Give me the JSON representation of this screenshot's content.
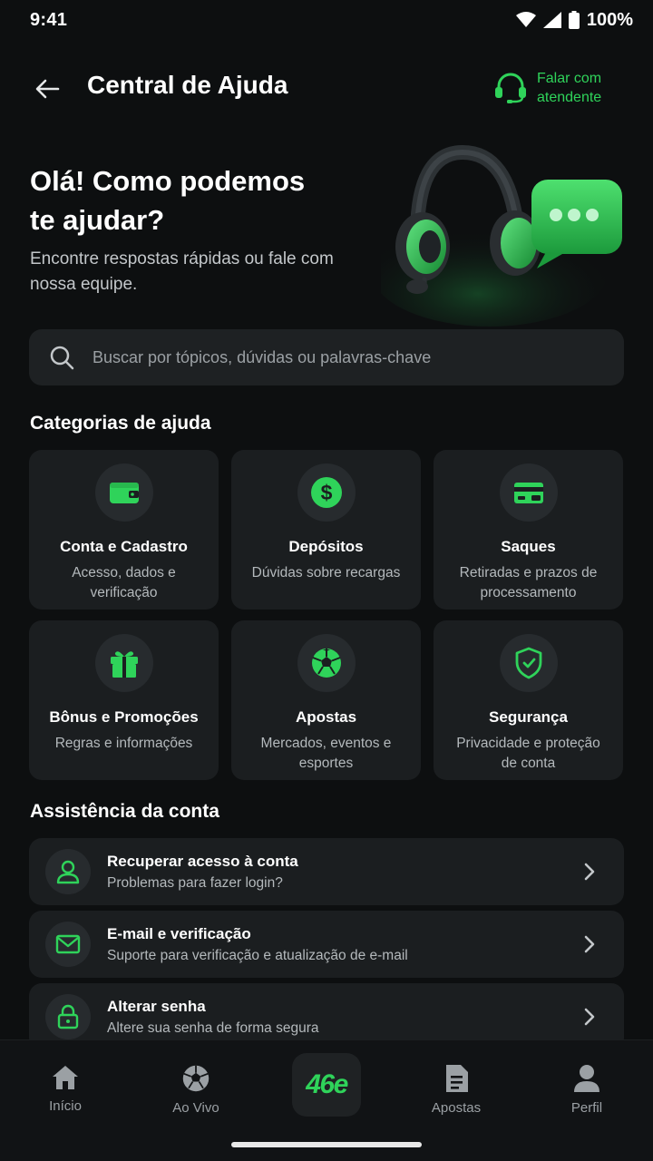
{
  "status_bar": {
    "time": "9:41",
    "battery": "100%"
  },
  "header": {
    "title": "Central de Ajuda",
    "support_label": "Falar com atendente"
  },
  "hero": {
    "title": "Olá! Como podemos te ajudar?",
    "subtitle": "Encontre respostas rápidas ou fale com nossa equipe."
  },
  "search": {
    "placeholder": "Buscar por tópicos, dúvidas ou palavras-chave",
    "value": ""
  },
  "categories": {
    "title": "Categorias de ajuda",
    "items": [
      {
        "title": "Conta e Cadastro",
        "desc": "Acesso, dados e verificação",
        "icon": "wallet-icon"
      },
      {
        "title": "Depósitos",
        "desc": "Dúvidas sobre recargas",
        "icon": "dollar-icon"
      },
      {
        "title": "Saques",
        "desc": "Retiradas e prazos de processamento",
        "icon": "card-icon"
      },
      {
        "title": "Bônus e Promoções",
        "desc": "Regras e informações",
        "icon": "gift-icon"
      },
      {
        "title": "Apostas",
        "desc": "Mercados, eventos e esportes",
        "icon": "soccer-ball-icon"
      },
      {
        "title": "Segurança",
        "desc": "Privacidade e proteção de conta",
        "icon": "shield-icon"
      }
    ]
  },
  "account": {
    "title": "Assistência da conta",
    "items": [
      {
        "title": "Recuperar acesso à conta",
        "sub": "Problemas para fazer login?",
        "icon": "user-icon"
      },
      {
        "title": "E-mail e verificação",
        "sub": "Suporte para verificação e atualização de e-mail",
        "icon": "mail-icon"
      },
      {
        "title": "Alterar senha",
        "sub": "Altere sua senha de forma segura",
        "icon": "lock-icon"
      }
    ]
  },
  "nav": {
    "items": [
      {
        "label": "Início",
        "icon": "home-icon"
      },
      {
        "label": "Ao Vivo",
        "icon": "soccer-ball-icon"
      },
      {
        "label": "Apostas",
        "icon": "document-icon"
      },
      {
        "label": "Perfil",
        "icon": "profile-icon"
      }
    ],
    "logo": "46e"
  },
  "colors": {
    "accent": "#2fd35a",
    "background": "#0d0f10",
    "card": "#1b1e20"
  }
}
